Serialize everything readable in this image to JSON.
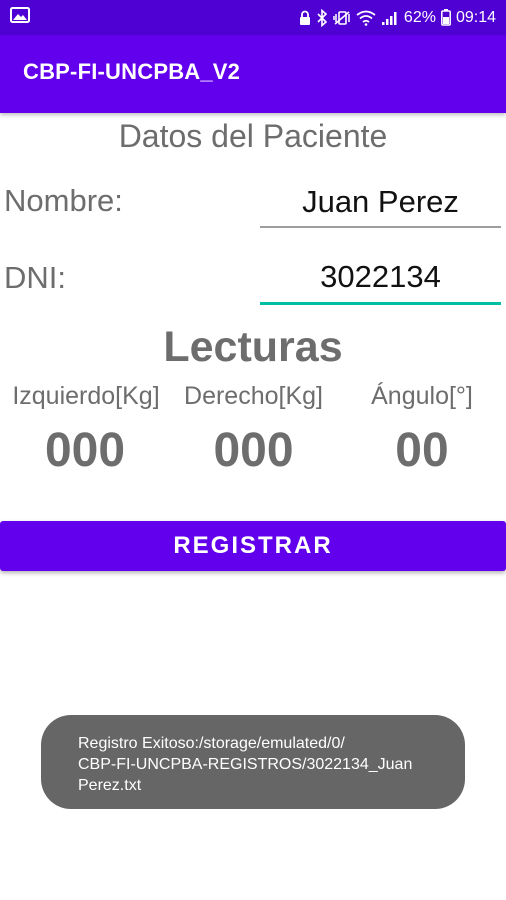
{
  "status_bar": {
    "battery": "62%",
    "time": "09:14",
    "icons": [
      "gallery-icon",
      "lock-icon",
      "bluetooth-icon",
      "vibrate-icon",
      "wifi-icon",
      "signal-icon",
      "battery-icon"
    ]
  },
  "app_bar": {
    "title": "CBP-FI-UNCPBA_V2"
  },
  "patient": {
    "section_title": "Datos del Paciente",
    "name_label": "Nombre:",
    "name_value": "Juan Perez",
    "dni_label": "DNI:",
    "dni_value": "3022134"
  },
  "readings": {
    "section_title": "Lecturas",
    "left_label": "Izquierdo[Kg]",
    "right_label": "Derecho[Kg]",
    "angle_label": "Ángulo[°]",
    "left_value": "000",
    "right_value": "000",
    "angle_value": "00"
  },
  "actions": {
    "register_label": "REGISTRAR"
  },
  "toast": {
    "line1": "Registro Exitoso:/storage/emulated/0/",
    "line2": "CBP-FI-UNCPBA-REGISTROS/3022134_Juan",
    "line3": "Perez.txt"
  },
  "colors": {
    "status_bar": "#4f00d3",
    "primary": "#6200ee",
    "accent": "#00bfa5",
    "toast_bg": "#666666"
  }
}
